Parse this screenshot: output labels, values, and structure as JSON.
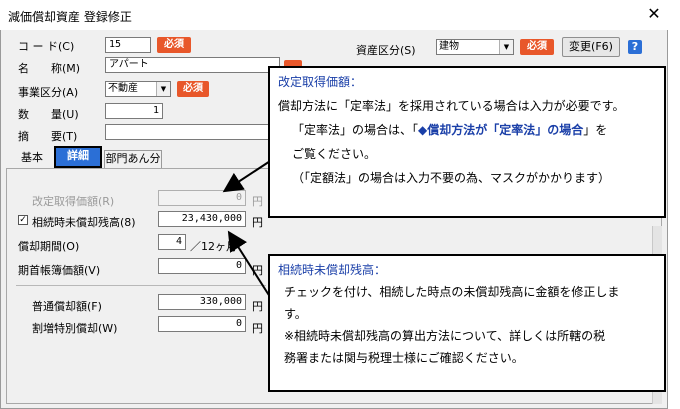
{
  "window": {
    "title": "減価償却資産 登録修正",
    "close": "✕"
  },
  "fields": {
    "code": {
      "label": "コ ー ド(C)",
      "value": "15"
    },
    "name": {
      "label": "名　　称(M)",
      "value": "アパート"
    },
    "business": {
      "label": "事業区分(A)",
      "value": "不動産"
    },
    "quantity": {
      "label": "数　　量(U)",
      "value": "1"
    },
    "summary": {
      "label": "摘　　要(T)",
      "value": ""
    },
    "asset_class": {
      "label": "資産区分(S)",
      "value": "建物"
    }
  },
  "required_label": "必須",
  "change_button": "変更(F6)",
  "help": "?",
  "tabs": [
    "基本",
    "詳細",
    "部門あん分"
  ],
  "detail": {
    "revised_cost": {
      "label": "改定取得価額(R)",
      "value": "0",
      "unit": "円"
    },
    "inherit_balance": {
      "label": "相続時未償却残高(8)",
      "value": "23,430,000",
      "unit": "円",
      "checked": true
    },
    "period": {
      "label": "償却期間(O)",
      "value": "4",
      "unit": "／12ヶ月"
    },
    "book_value": {
      "label": "期首帳簿価額(V)",
      "value": "0",
      "unit": "円"
    },
    "normal_dep": {
      "label": "普通償却額(F)",
      "value": "330,000",
      "unit": "円"
    },
    "extra_dep": {
      "label": "割増特別償却(W)",
      "value": "0",
      "unit": "円"
    }
  },
  "callout1": {
    "heading": "改定取得価額：",
    "line1": "償却方法に「定率法」を採用されている場合は入力が必要です。",
    "line2_pre": "「定率法」の場合は、「",
    "line2_link": "◆償却方法が「定率法」の場合",
    "line2_post": "」を",
    "line3": "ご覧ください。",
    "line4": "（「定額法」の場合は入力不要の為、マスクがかかります）"
  },
  "callout2": {
    "heading": "相続時未償却残高：",
    "line1": "チェックを付け、相続した時点の未償却残高に金額を修正しま",
    "line2": "す。",
    "line3": "※相続時未償却残高の算出方法について、詳しくは所轄の税",
    "line4": "務署または関与税理士様にご確認ください。"
  },
  "colors": {
    "required": "#e8572a",
    "tab_active": "#2b6fd6",
    "callout_heading": "#1a3fa8"
  }
}
